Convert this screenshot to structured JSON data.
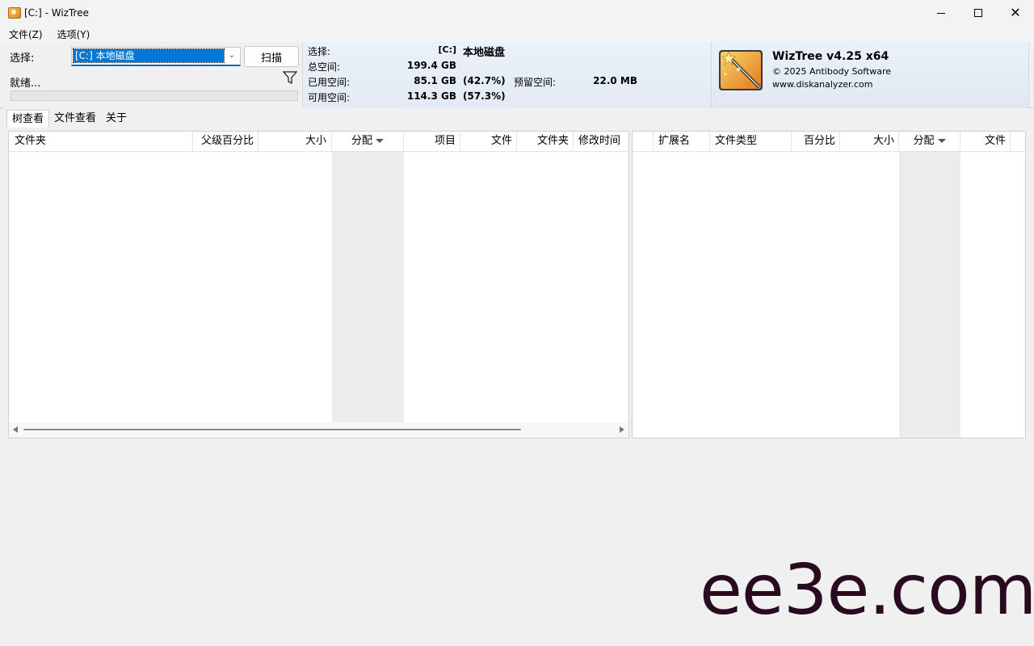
{
  "window": {
    "title": "[C:]  - WizTree",
    "controls": {
      "minimize": "minimize-icon",
      "maximize": "maximize-icon",
      "close": "close-icon"
    }
  },
  "menu": {
    "items": [
      "文件(Z)",
      "选项(Y)"
    ]
  },
  "scan": {
    "select_label": "选择:",
    "drive_value": "[C:] 本地磁盘",
    "scan_button": "扫描",
    "status": "就绪..."
  },
  "info": {
    "select_label": "选择:",
    "drive": "[C:]",
    "drive_name": "本地磁盘",
    "total_label": "总空间:",
    "total_value": "199.4 GB",
    "used_label": "已用空间:",
    "used_value": "85.1 GB",
    "used_pct": "(42.7%)",
    "reserved_label": "预留空间:",
    "reserved_value": "22.0 MB",
    "free_label": "可用空间:",
    "free_value": "114.3 GB",
    "free_pct": "(57.3%)"
  },
  "brand": {
    "title": "WizTree v4.25 x64",
    "copyright": "© 2025 Antibody Software",
    "url": "www.diskanalyzer.com"
  },
  "tabs": [
    "树查看",
    "文件查看",
    "关于"
  ],
  "tree_columns": [
    "文件夹",
    "父级百分比",
    "大小",
    "分配",
    "项目",
    "文件",
    "文件夹",
    "修改时间"
  ],
  "ext_columns": [
    "扩展名",
    "文件类型",
    "百分比",
    "大小",
    "分配",
    "文件"
  ],
  "watermark": "ee3e.com",
  "colors": {
    "selection": "#0078d7",
    "info_bg": "#eaf1f8",
    "watermark": "#2a0a1f"
  }
}
